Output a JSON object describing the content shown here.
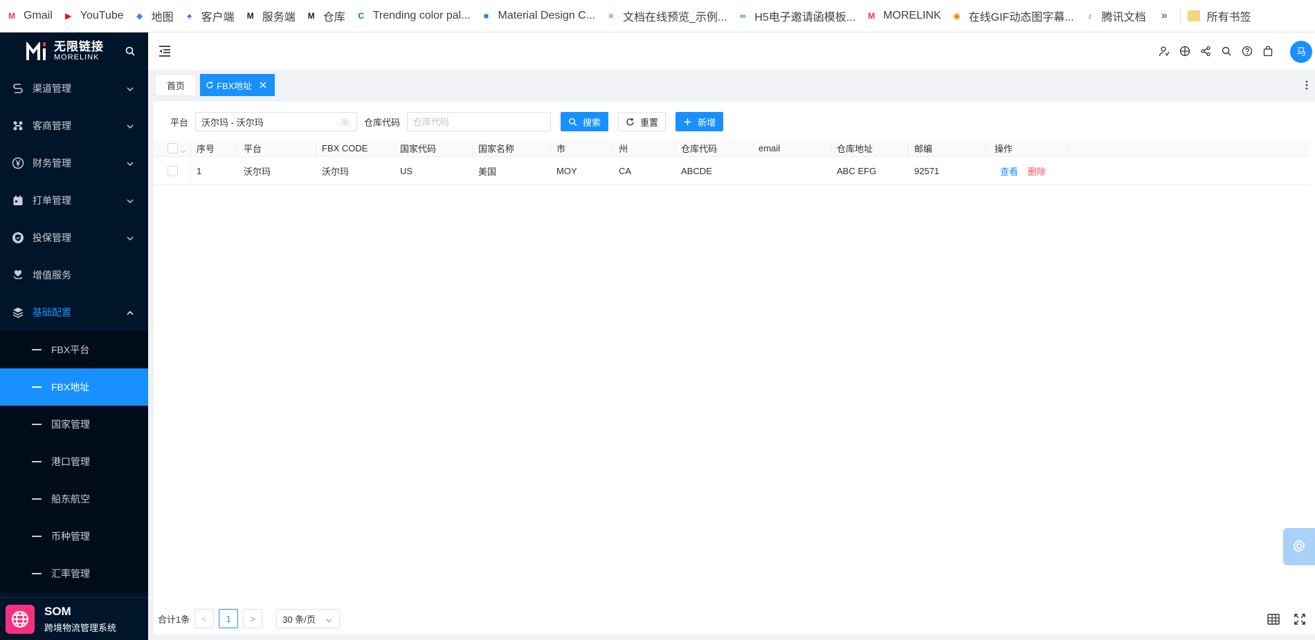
{
  "bookmarks": [
    {
      "label": "Gmail",
      "icon": "gmail-icon",
      "color": "#ea4335",
      "glyph": "M"
    },
    {
      "label": "YouTube",
      "icon": "youtube-icon",
      "color": "#ff0000",
      "glyph": "▶"
    },
    {
      "label": "地图",
      "icon": "map-icon",
      "color": "#4285f4",
      "glyph": "◆"
    },
    {
      "label": "客户端",
      "icon": "client-icon",
      "color": "#1a73e8",
      "glyph": "♠"
    },
    {
      "label": "服务端",
      "icon": "morelink-icon",
      "color": "#202124",
      "glyph": "M"
    },
    {
      "label": "仓库",
      "icon": "morelink-icon",
      "color": "#202124",
      "glyph": "M"
    },
    {
      "label": "Trending color pal...",
      "icon": "coolors-icon",
      "color": "#0066ff",
      "glyph": "C"
    },
    {
      "label": "Material Design C...",
      "icon": "material-icon",
      "color": "#1e88e5",
      "glyph": "■"
    },
    {
      "label": "文档在线预览_示例...",
      "icon": "doc-icon",
      "color": "#1a73e8",
      "glyph": "≡"
    },
    {
      "label": "H5电子邀请函模板...",
      "icon": "h5-icon",
      "color": "#1677ff",
      "glyph": "∞"
    },
    {
      "label": "MORELINK",
      "icon": "morelink-red-icon",
      "color": "#e53935",
      "glyph": "M"
    },
    {
      "label": "在线GIF动态图字幕...",
      "icon": "gif-icon",
      "color": "#f57c00",
      "glyph": "◉"
    },
    {
      "label": "腾讯文档",
      "icon": "tencent-doc-icon",
      "color": "#1e6fff",
      "glyph": "♪"
    }
  ],
  "bookmarks_more": "»",
  "bookmarks_folder": "所有书签",
  "brand": {
    "cn": "无限链接",
    "en": "MORELINK"
  },
  "sidebar": {
    "items": [
      {
        "label": "渠道管理"
      },
      {
        "label": "客商管理"
      },
      {
        "label": "财务管理"
      },
      {
        "label": "打单管理"
      },
      {
        "label": "投保管理"
      },
      {
        "label": "增值服务"
      },
      {
        "label": "基础配置"
      }
    ],
    "sub_items": [
      {
        "label": "FBX平台"
      },
      {
        "label": "FBX地址"
      },
      {
        "label": "国家管理"
      },
      {
        "label": "港口管理"
      },
      {
        "label": "船东航空"
      },
      {
        "label": "币种管理"
      },
      {
        "label": "汇率管理"
      }
    ]
  },
  "footer": {
    "title": "SOM",
    "subtitle": "跨境物流管理系统"
  },
  "header": {
    "avatar": "马"
  },
  "tabs": {
    "home": "首页",
    "active": "FBX地址"
  },
  "filter": {
    "platform_label": "平台",
    "platform_value": "沃尔玛 - 沃尔玛",
    "warehouse_label": "仓库代码",
    "warehouse_placeholder": "仓库代码",
    "search": "搜索",
    "reset": "重置",
    "add": "新增"
  },
  "table": {
    "columns": [
      "序号",
      "平台",
      "FBX CODE",
      "国家代码",
      "国家名称",
      "市",
      "州",
      "仓库代码",
      "email",
      "仓库地址",
      "邮编",
      "操作"
    ],
    "rows": [
      [
        "1",
        "沃尔玛",
        "沃尔玛",
        "US",
        "美国",
        "MOY",
        "CA",
        "ABCDE",
        "",
        "ABC EFG",
        "92571"
      ]
    ],
    "actions": {
      "view": "查看",
      "delete": "删除"
    }
  },
  "pager": {
    "total": "合计1条",
    "prev": "<",
    "page": "1",
    "next": ">",
    "size": "30 条/页"
  },
  "colors": {
    "primary": "#1890ff",
    "sidebar": "#001529",
    "danger": "#ff4d4f"
  }
}
